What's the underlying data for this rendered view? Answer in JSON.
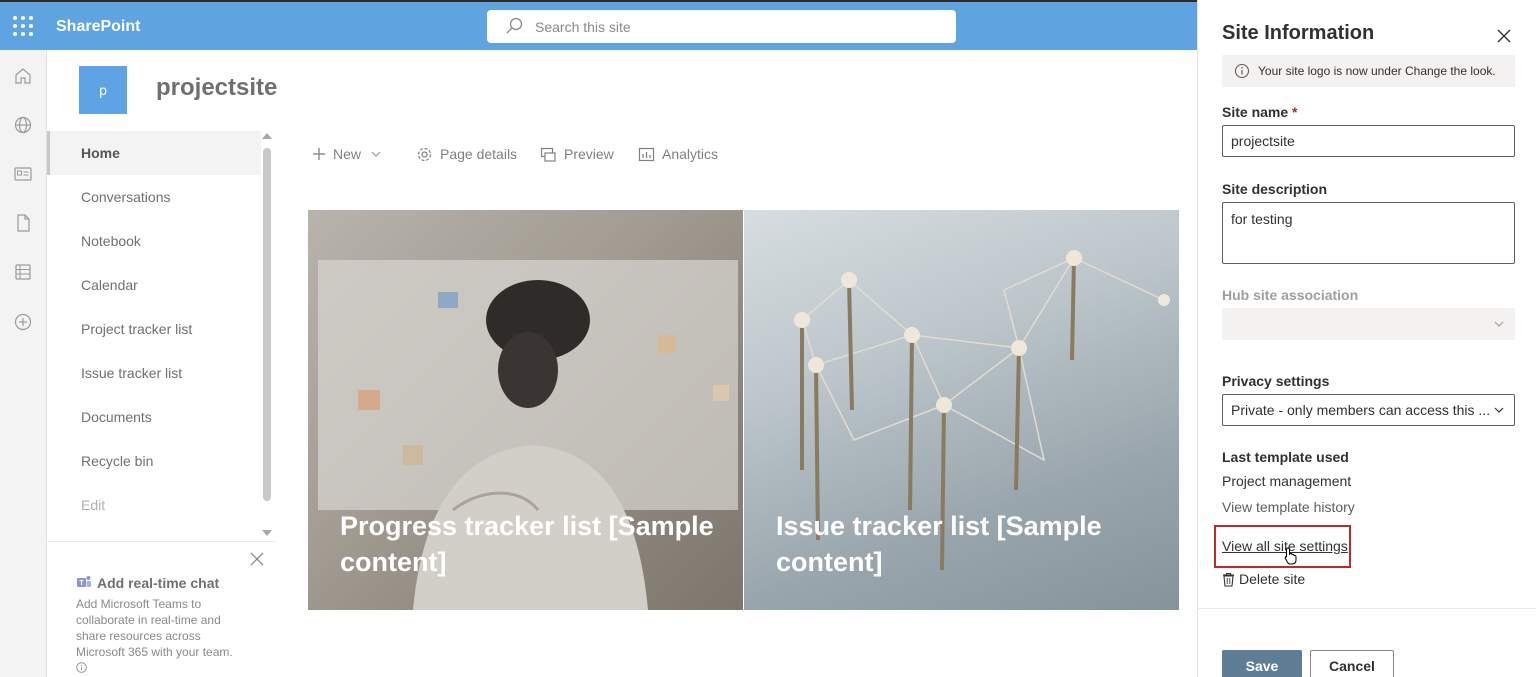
{
  "suitebar": {
    "brand": "SharePoint",
    "search_placeholder": "Search this site"
  },
  "appbar": {
    "icons": [
      "home-icon",
      "globe-icon",
      "news-icon",
      "file-icon",
      "list-icon",
      "add-icon"
    ]
  },
  "site": {
    "logo_letter": "p",
    "title": "projectsite"
  },
  "leftnav": {
    "items": [
      {
        "label": "Home",
        "active": true
      },
      {
        "label": "Conversations"
      },
      {
        "label": "Notebook"
      },
      {
        "label": "Calendar"
      },
      {
        "label": "Project tracker list"
      },
      {
        "label": "Issue tracker list"
      },
      {
        "label": "Documents"
      },
      {
        "label": "Recycle bin"
      },
      {
        "label": "Edit"
      }
    ]
  },
  "chat_card": {
    "title": "Add real-time chat",
    "body": "Add Microsoft Teams to collaborate in real-time and share resources across Microsoft 365 with your team."
  },
  "commands": {
    "new": "New",
    "page_details": "Page details",
    "preview": "Preview",
    "analytics": "Analytics"
  },
  "tiles": [
    {
      "text": "Progress tracker list [Sample content]"
    },
    {
      "text": "Issue tracker list [Sample content]"
    }
  ],
  "panel": {
    "title": "Site Information",
    "info": "Your site logo is now under Change the look.",
    "site_name_label": "Site name",
    "required_marker": "*",
    "site_name_value": "projectsite",
    "site_description_label": "Site description",
    "site_description_value": "for testing",
    "hub_label": "Hub site association",
    "hub_value": "",
    "privacy_label": "Privacy settings",
    "privacy_value": "Private - only members can access this ...",
    "template_label": "Last template used",
    "template_value": "Project management",
    "template_history": "View template history",
    "view_all_settings": "View all site settings",
    "delete_site": "Delete site",
    "save": "Save",
    "cancel": "Cancel",
    "highlight_color": "#c1272d"
  }
}
